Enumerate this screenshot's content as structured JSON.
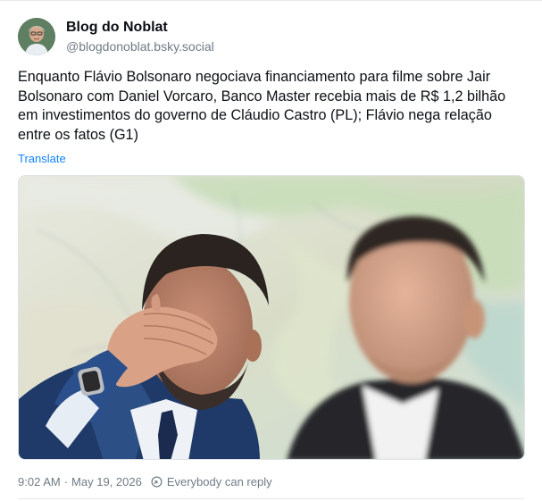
{
  "author": {
    "display_name": "Blog do Noblat",
    "handle": "@blogdonoblat.bsky.social"
  },
  "post": {
    "text": "Enquanto Flávio Bolsonaro negociava financiamento para filme sobre Jair Bolsonaro com Daniel Vorcaro, Banco Master recebia mais de R$ 1,2 bilhão em investimentos do governo de Cláudio Castro (PL); Flávio nega relação entre os fatos (G1)",
    "translate_label": "Translate"
  },
  "meta": {
    "time": "9:02 AM",
    "separator": "·",
    "date": "May 19, 2026",
    "reply_setting": "Everybody can reply"
  },
  "colors": {
    "link": "#1083fe",
    "muted": "#6f7b86",
    "text": "#0b0f14"
  },
  "icons": {
    "avatar": "avatar-photo",
    "reply_setting": "globe-icon",
    "image": "post-photo"
  }
}
